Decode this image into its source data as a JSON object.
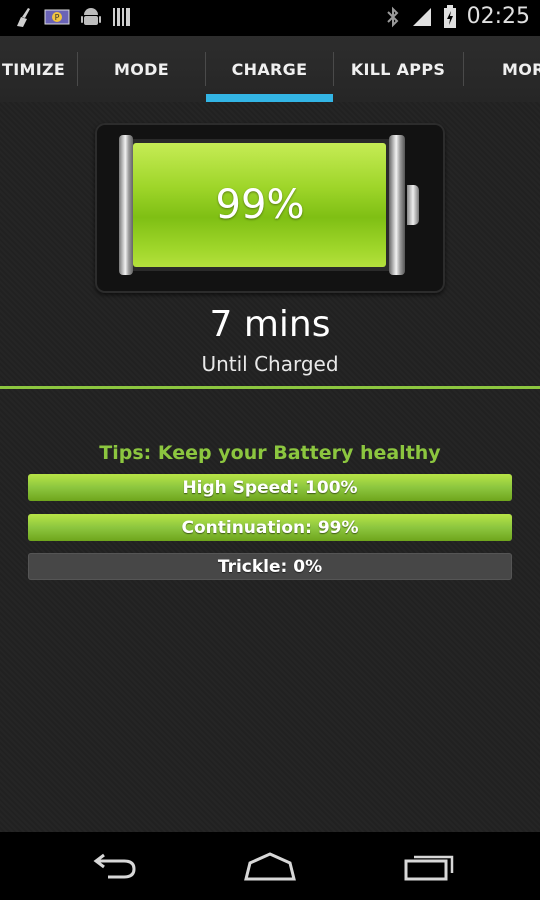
{
  "status_bar": {
    "time": "02:25",
    "icons_left": [
      "broom-icon",
      "p-notification-icon",
      "android-icon",
      "barcode-icon"
    ],
    "icons_right": [
      "bluetooth-icon",
      "signal-icon",
      "battery-charging-icon"
    ]
  },
  "tabs": [
    {
      "label": "TIMIZE"
    },
    {
      "label": "MODE"
    },
    {
      "label": "CHARGE",
      "selected": true
    },
    {
      "label": "KILL APPS"
    },
    {
      "label": "MOR"
    }
  ],
  "battery": {
    "percent_label": "99%",
    "level": 0.99
  },
  "charge": {
    "time_left": "7 mins",
    "until_label": "Until Charged"
  },
  "tips": {
    "title": "Tips: Keep your Battery healthy",
    "stages": [
      {
        "label": "High Speed: 100%",
        "progress": 1.0
      },
      {
        "label": "Continuation: 99%",
        "progress": 1.0
      },
      {
        "label": "Trickle: 0%",
        "progress": 0.0
      }
    ]
  },
  "colors": {
    "accent_green": "#8cc63f",
    "tab_indicator": "#33b5e5"
  },
  "nav": {
    "buttons": [
      "back-icon",
      "home-icon",
      "recent-apps-icon"
    ]
  }
}
